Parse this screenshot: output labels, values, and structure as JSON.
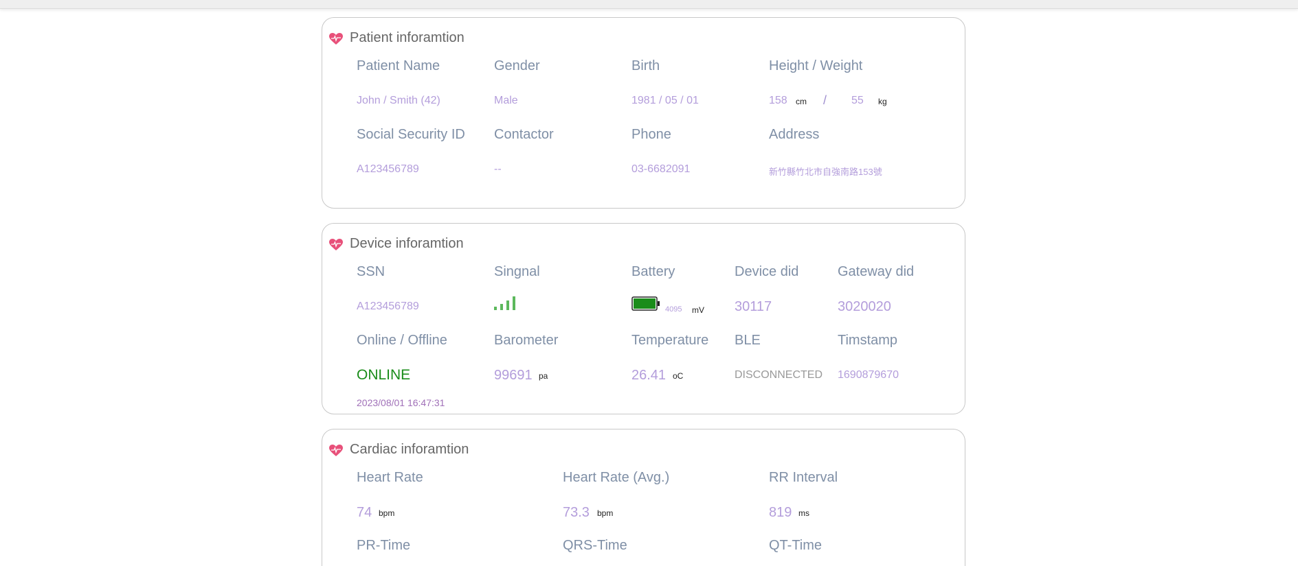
{
  "patient": {
    "title": "Patient inforamtion",
    "labels": {
      "name": "Patient Name",
      "gender": "Gender",
      "birth": "Birth",
      "height_weight": "Height / Weight",
      "ssid": "Social Security ID",
      "contactor": "Contactor",
      "phone": "Phone",
      "address": "Address"
    },
    "values": {
      "name": "John / Smith (42)",
      "gender": "Male",
      "birth": "1981 / 05 / 01",
      "height": "158",
      "height_unit": "cm",
      "separator": "/",
      "weight": "55",
      "weight_unit": "kg",
      "ssid": "A123456789",
      "contactor": "--",
      "phone": "03-6682091",
      "address": "新竹縣竹北市自強南路153號"
    }
  },
  "device": {
    "title": "Device inforamtion",
    "labels": {
      "ssn": "SSN",
      "signal": "Singnal",
      "battery": "Battery",
      "device_did": "Device did",
      "gateway_did": "Gateway did",
      "online": "Online / Offline",
      "barometer": "Barometer",
      "temperature": "Temperature",
      "ble": "BLE",
      "timestamp": "Timstamp"
    },
    "values": {
      "ssn": "A123456789",
      "signal_icon": "signal-bars-icon",
      "battery_icon": "battery-full-icon",
      "battery_level": 1.0,
      "battery_mv": "4095",
      "battery_unit": "mV",
      "device_did": "30117",
      "gateway_did": "3020020",
      "online": "ONLINE",
      "barometer": "99691",
      "barometer_unit": "pa",
      "temperature": "26.41",
      "temperature_unit": "oC",
      "ble": "DISCONNECTED",
      "timestamp": "1690879670",
      "datetime": "2023/08/01 16:47:31"
    }
  },
  "cardiac": {
    "title": "Cardiac inforamtion",
    "labels": {
      "hr": "Heart Rate",
      "hr_avg": "Heart Rate (Avg.)",
      "rr": "RR Interval",
      "pr": "PR-Time",
      "qrs": "QRS-Time",
      "qt": "QT-Time"
    },
    "values": {
      "hr": "74",
      "hr_unit": "bpm",
      "hr_avg": "73.3",
      "hr_avg_unit": "bpm",
      "rr": "819",
      "rr_unit": "ms"
    }
  },
  "colors": {
    "label": "#7f8fa6",
    "value": "#b39ddb",
    "online": "#1a8c1a",
    "heart": "#e8507a",
    "battery": "#1a8c1a",
    "signal": "#5cb85c"
  }
}
